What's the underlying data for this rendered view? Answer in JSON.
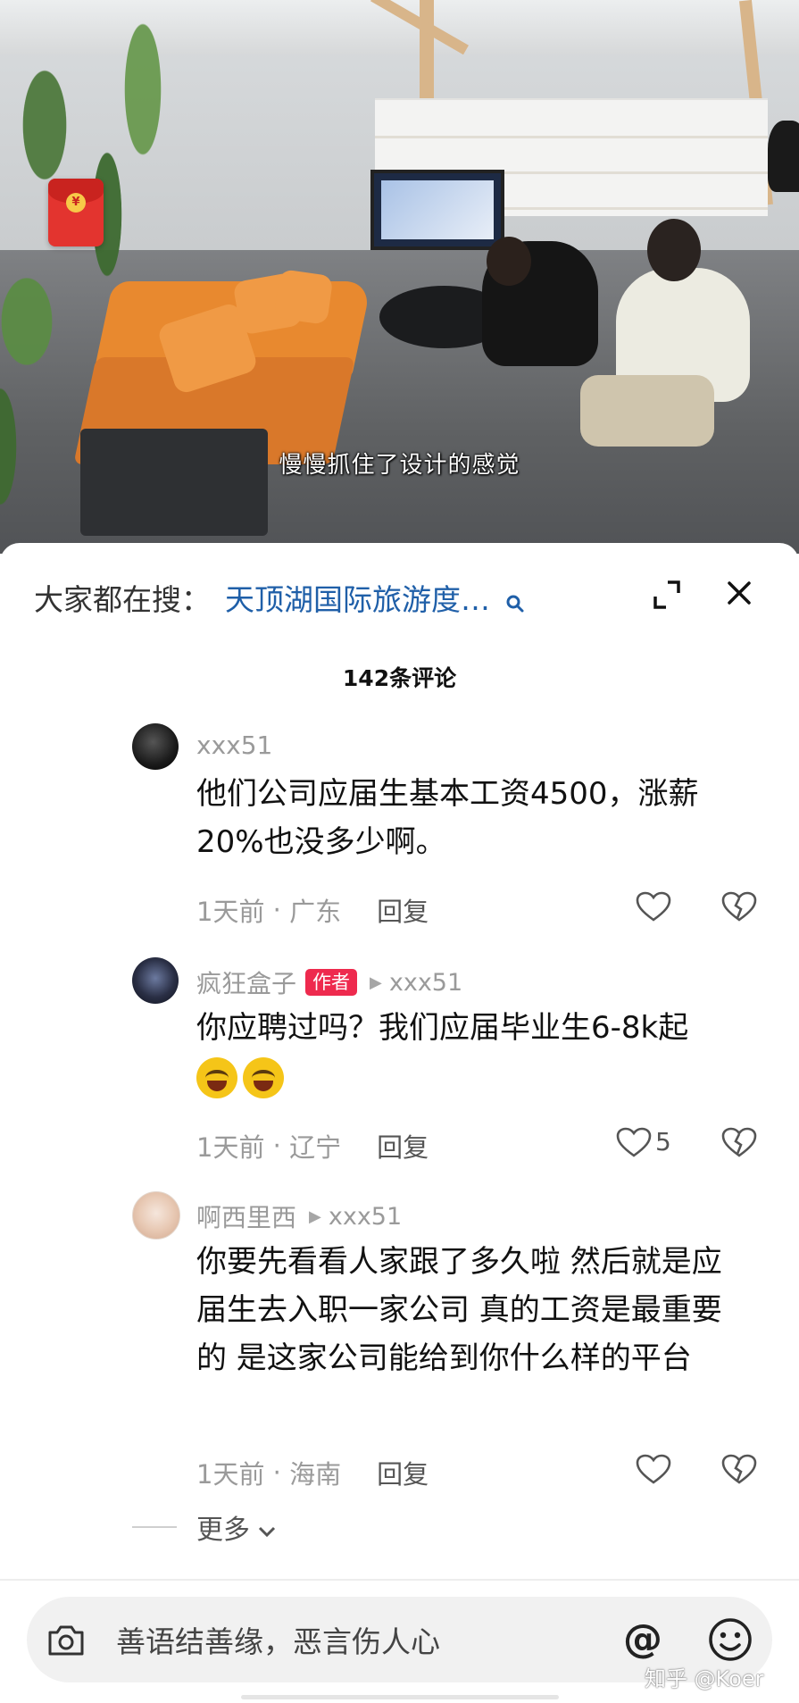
{
  "video": {
    "subtitle": "慢慢抓住了设计的感觉",
    "red_envelope_symbol": "¥"
  },
  "search": {
    "prefix": "大家都在搜：",
    "query": "天顶湖国际旅游度…",
    "search_icon": "search-icon"
  },
  "controls": {
    "expand_icon": "expand-icon",
    "close_icon": "close-icon"
  },
  "comments_header": {
    "count_label": "142条评论"
  },
  "comments": [
    {
      "username": "xxx51",
      "text": "他们公司应届生基本工资4500，涨薪20%也没多少啊。",
      "time": "1天前",
      "location": "广东",
      "reply_label": "回复",
      "likes": ""
    },
    {
      "username": "疯狂盒子",
      "author_tag": "作者",
      "reply_to": "xxx51",
      "text": "你应聘过吗？我们应届毕业生6-8k起",
      "time": "1天前",
      "location": "辽宁",
      "reply_label": "回复",
      "likes": "5"
    },
    {
      "username": "啊西里西",
      "reply_to": "xxx51",
      "text": "你要先看看人家跟了多久啦 然后就是应届生去入职一家公司 真的工资是最重要的 是这家公司能给到你什么样的平台",
      "time": "1天前",
      "location": "海南",
      "reply_label": "回复",
      "likes": ""
    }
  ],
  "more_label": "更多",
  "input": {
    "placeholder": "善语结善缘，恶言伤人心",
    "at_symbol": "@"
  },
  "watermark": "知乎 @Koer",
  "colors": {
    "author_tag": "#ee2a4e",
    "search_link": "#1f5fa8",
    "meta_gray": "#9a9a9a"
  }
}
